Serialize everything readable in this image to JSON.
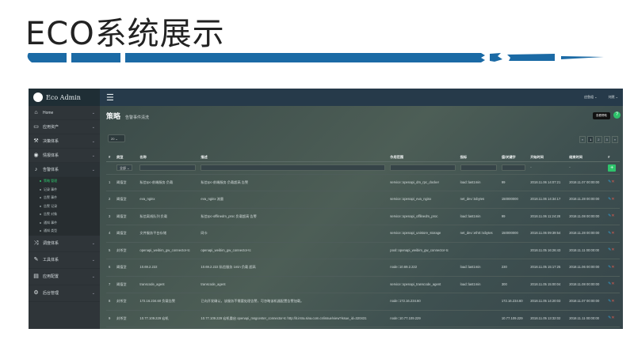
{
  "slide": {
    "title": "ECO系统展示"
  },
  "app": {
    "name": "Eco Admin",
    "topbar": {
      "right_items": [
        "应急组 ⌄",
        "刘然 ⌄"
      ]
    }
  },
  "sidebar": {
    "items": [
      {
        "label": "Home",
        "icon": "home-icon",
        "glyph": "⌂"
      },
      {
        "label": "应用资产",
        "icon": "monitor-icon",
        "glyph": "▭"
      },
      {
        "label": "决策体系",
        "icon": "gavel-icon",
        "glyph": "⚒"
      },
      {
        "label": "情报体系",
        "icon": "eye-icon",
        "glyph": "◉"
      },
      {
        "label": "告警体系",
        "icon": "bell-icon",
        "glyph": "♪"
      }
    ],
    "subitems": [
      {
        "label": "策略 管理",
        "active": true
      },
      {
        "label": "记录 事件",
        "active": false
      },
      {
        "label": "告警 事件",
        "active": false
      },
      {
        "label": "告警 记录",
        "active": false
      },
      {
        "label": "告警 对象",
        "active": false
      },
      {
        "label": "通知 事件",
        "active": false
      },
      {
        "label": "通知 类型",
        "active": false
      }
    ],
    "lower_items": [
      {
        "label": "调度体系",
        "icon": "shuffle-icon",
        "glyph": "⤨"
      },
      {
        "label": "工具体系",
        "icon": "wrench-icon",
        "glyph": "✎"
      },
      {
        "label": "应用配置",
        "icon": "book-icon",
        "glyph": "▤"
      },
      {
        "label": "后台管理",
        "icon": "gears-icon",
        "glyph": "⚙"
      }
    ]
  },
  "page": {
    "title": "策略",
    "subtitle": "告警事件清洗",
    "help_button": "查看帮助",
    "help_icon": "?",
    "page_size": "20 ⌄",
    "pager": [
      "«",
      "1",
      "2",
      "3",
      "»"
    ],
    "columns": [
      "#",
      "类型",
      "名称",
      "描述",
      "作用范围",
      "指标",
      "值/关键字",
      "开始时间",
      "结束时间",
      "#"
    ],
    "filter": {
      "type_select": "全部 ⌄",
      "start_placeholder": "-",
      "end_placeholder": "-",
      "add_label": "+"
    },
    "rows": [
      {
        "no": "1",
        "type": "阈值型",
        "name": "私信rpc-前端服务 负载",
        "desc": "私信rpc-前端服务 负载超高 告警",
        "scope": "service::openapi_dm_rpc_docker",
        "metric": "load::last1min",
        "value": "99",
        "start": "2018.11.06 14:07:21",
        "end": "2018.11.07 00:00:00"
      },
      {
        "no": "2",
        "type": "阈值型",
        "name": "eva_nginx",
        "desc": "eva_nginx 流量",
        "scope": "service::openapi_eva_nginx",
        "metric": "net_dev::txbytes",
        "value": "150000000",
        "start": "2018.11.06 14:34:17",
        "end": "2018.11.28 00:00:00"
      },
      {
        "no": "3",
        "type": "阈值型",
        "name": "私信离线队列 负载",
        "desc": "私信rpc-offlinedm_proc 负载超高 告警",
        "scope": "service::openapi_offlinedm_proc",
        "metric": "load::last1min",
        "value": "99",
        "start": "2018.11.06 11:24:28",
        "end": "2018.11.08 00:00:00"
      },
      {
        "no": "4",
        "type": "阈值型",
        "name": "文件服务平台存储",
        "desc": "网卡",
        "scope": "service::openapi_unistore_storage",
        "metric": "net_dev::eth0::txbytes",
        "value": "150000000",
        "start": "2018.11.06 09:39:54",
        "end": "2018.11.28 00:00:00"
      },
      {
        "no": "5",
        "type": "封杀型",
        "name": "openapi_weibim_gw_connector-tc",
        "desc": "openapi_weibim_gw_connector-tc",
        "scope": "pool::openapi_weibim_gw_connector-tc",
        "metric": "",
        "value": "",
        "start": "2018.11.05 16:26:43",
        "end": "2018.11.11 00:00:00"
      },
      {
        "no": "6",
        "type": "阈值型",
        "name": "10.69.2.222",
        "desc": "10.69.2.222 私信服务 1min 负载 超高",
        "scope": "node::10.69.2.222",
        "metric": "load::last1min",
        "value": "230",
        "start": "2018.11.05 15:17:25",
        "end": "2018.11.06 00:00:00"
      },
      {
        "no": "7",
        "type": "阈值型",
        "name": "transcode_agent",
        "desc": "transcode_agent",
        "scope": "service::openapi_transcode_agent",
        "metric": "load::last1min",
        "value": "300",
        "start": "2018.11.05 15:00:04",
        "end": "2018.11.08 00:00:00"
      },
      {
        "no": "8",
        "type": "封杀型",
        "name": "172.16.234.60 负载告警",
        "desc": "已向开发确认，该服务不需要处理告警，可忽略该机器配置告警加载。",
        "scope": "node::172.16.234.60",
        "metric": "",
        "value": "172.16.234.60",
        "start": "2018.11.05 14:20:03",
        "end": "2018.11.07 00:00:00"
      },
      {
        "no": "9",
        "type": "封杀型",
        "name": "10.77.109.229 宕机",
        "desc": "10.77.109.229 宕机重启 openapi_msgcenter_connector-tc http://it.intra.sina.com.cn/issue/view?issue_id=320431",
        "scope": "node::10.77.109.229",
        "metric": "",
        "value": "10.77.109.229",
        "start": "2018.11.05 13:32:02",
        "end": "2018.11.11 00:00:00"
      }
    ]
  },
  "colors": {
    "brand_blue": "#1b6aa5",
    "accent_green": "#2ec36b",
    "danger": "#e35b4f",
    "link_blue": "#33a3d8"
  }
}
